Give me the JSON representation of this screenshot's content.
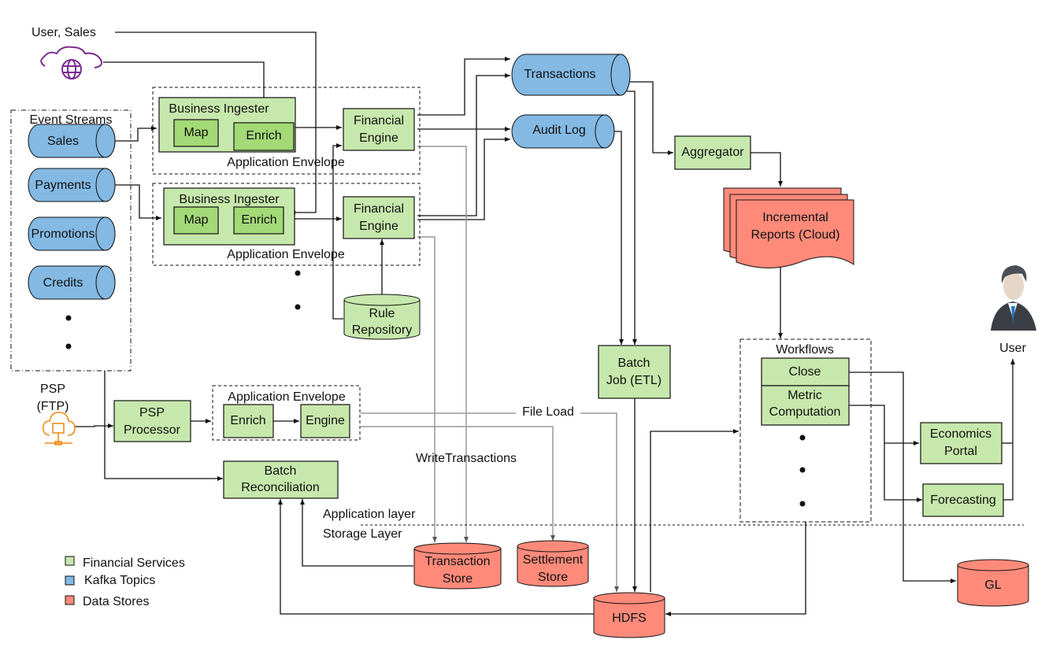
{
  "colors": {
    "financial_service": "#c7e8ac",
    "financial_service_inner": "#a3d977",
    "kafka_topic": "#83b9e3",
    "data_store": "#ff8a7a",
    "cloud_icon": "#7a2b8f",
    "ftp_icon": "#f28c1a",
    "stroke": "#111111",
    "gray_line": "#999999"
  },
  "labels": {
    "user_sales": "User, Sales",
    "event_streams": "Event Streams",
    "psp_ftp_line1": "PSP",
    "psp_ftp_line2": "(FTP)",
    "file_load": "File Load",
    "write_transactions": "WriteTransactions",
    "application_layer": "Application layer",
    "storage_layer": "Storage Layer",
    "user": "User",
    "workflows": "Workflows"
  },
  "event_streams": [
    "Sales",
    "Payments",
    "Promotions",
    "Credits"
  ],
  "envelopes": [
    {
      "label": "Application Envelope",
      "ingester": "Business Ingester",
      "map": "Map",
      "enrich": "Enrich",
      "engine_line1": "Financial",
      "engine_line2": "Engine"
    },
    {
      "label": "Application Envelope",
      "ingester": "Business Ingester",
      "map": "Map",
      "enrich": "Enrich",
      "engine_line1": "Financial",
      "engine_line2": "Engine"
    }
  ],
  "psp_envelope": {
    "label": "Application Envelope",
    "enrich": "Enrich",
    "engine": "Engine"
  },
  "nodes": {
    "psp_processor": [
      "PSP",
      "Processor"
    ],
    "batch_reconciliation": [
      "Batch",
      "Reconciliation"
    ],
    "rule_repository": [
      "Rule",
      "Repository"
    ],
    "transactions": "Transactions",
    "audit_log": "Audit Log",
    "aggregator": "Aggregator",
    "incremental_reports": [
      "Incremental",
      "Reports (Cloud)"
    ],
    "batch_job": [
      "Batch",
      "Job (ETL)"
    ],
    "close": "Close",
    "metric_computation": [
      "Metric",
      "Computation"
    ],
    "economics_portal": [
      "Economics",
      "Portal"
    ],
    "forecasting": "Forecasting",
    "transaction_store": [
      "Transaction",
      "Store"
    ],
    "settlement_store": [
      "Settlement",
      "Store"
    ],
    "hdfs": "HDFS",
    "gl": "GL"
  },
  "legend": [
    {
      "label": "Financial Services",
      "color": "#c7e8ac"
    },
    {
      "label": "Kafka Topics",
      "color": "#83b9e3"
    },
    {
      "label": "Data Stores",
      "color": "#ff8a7a"
    }
  ]
}
